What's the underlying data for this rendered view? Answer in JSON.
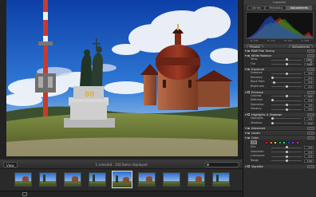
{
  "filmstrip": {
    "view_label": "View",
    "count_label": "1 selected · 150 items displayed",
    "search_placeholder": "",
    "status_text": ""
  },
  "inspector": {
    "title": "Inspector",
    "tabs": [
      "Library",
      "Metadata",
      "Adjustments"
    ],
    "active_tab": "Adjustments",
    "histogram_readout": [
      "R: 130",
      "G: 131",
      "B: 122",
      "L: 129"
    ],
    "presets_label": "Presets",
    "adjustments_label": "Adjustments",
    "sections": [
      {
        "title": "RAW Fine Tuning",
        "rows": []
      },
      {
        "title": "White Balance",
        "rows": [
          {
            "name": "Temp",
            "value": "5000 K",
            "level": 0.5
          },
          {
            "name": "Tint",
            "value": "0.00",
            "level": 0.5
          }
        ]
      },
      {
        "title": "Exposure",
        "rows": [
          {
            "name": "Exposure",
            "value": "0.0",
            "level": 0.5
          },
          {
            "name": "Recovery",
            "value": "0.0",
            "level": 0.0
          },
          {
            "name": "Black Point",
            "value": "0.0",
            "level": 0.06
          },
          {
            "name": "Brightness",
            "value": "0.0",
            "level": 0.5
          }
        ]
      },
      {
        "title": "Enhance",
        "rows": [
          {
            "name": "Contrast",
            "value": "0.0",
            "level": 0.5
          },
          {
            "name": "Definition",
            "value": "0.0",
            "level": 0.0
          },
          {
            "name": "Saturation",
            "value": "1.0",
            "level": 0.5
          },
          {
            "name": "Vibrancy",
            "value": "0.0",
            "level": 0.5
          }
        ]
      },
      {
        "title": "Highlights & Shadows",
        "rows": [
          {
            "name": "Highlights",
            "value": "0.0",
            "level": 0.0
          },
          {
            "name": "Shadows",
            "value": "0.0",
            "level": 0.0
          }
        ]
      },
      {
        "title": "Advanced",
        "rows": []
      },
      {
        "title": "Levels",
        "rows": []
      },
      {
        "title": "Color",
        "rows": []
      },
      {
        "title": "Vignette",
        "rows": []
      }
    ],
    "color_swatches": [
      "#d22",
      "#e80",
      "#dd2",
      "#2b2",
      "#2cc",
      "#24d",
      "#a2d",
      "#d2a"
    ],
    "color_rows": [
      {
        "name": "Hue",
        "value": "0.0",
        "level": 0.5
      },
      {
        "name": "Saturation",
        "value": "0.0",
        "level": 0.5
      },
      {
        "name": "Luminance",
        "value": "0.0",
        "level": 0.5
      },
      {
        "name": "Range",
        "value": "1.00",
        "level": 0.5
      }
    ]
  }
}
